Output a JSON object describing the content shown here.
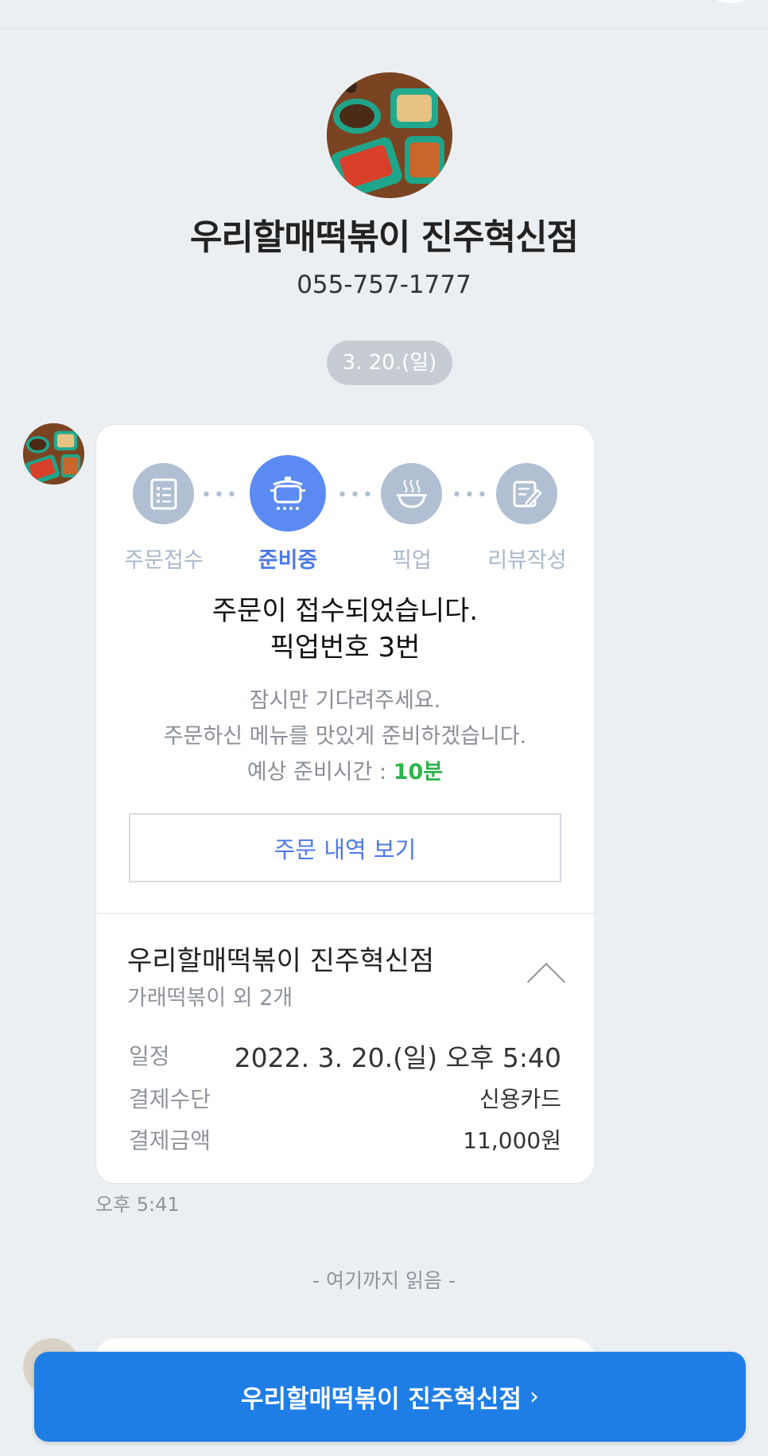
{
  "store": {
    "name": "우리할매떡볶이 진주혁신점",
    "phone": "055-757-1777"
  },
  "chat": {
    "date_chip": "3. 20.(일)",
    "message_time": "오후 5:41",
    "read_marker": "- 여기까지 읽음 -"
  },
  "order_card": {
    "steps": [
      {
        "label": "주문접수",
        "icon": "order-list-icon",
        "active": false
      },
      {
        "label": "준비중",
        "icon": "cooking-pot-icon",
        "active": true
      },
      {
        "label": "픽업",
        "icon": "food-bowl-icon",
        "active": false
      },
      {
        "label": "리뷰작성",
        "icon": "review-write-icon",
        "active": false
      }
    ],
    "status_line1": "주문이 접수되었습니다.",
    "status_line2": "픽업번호 3번",
    "sub_line1": "잠시만 기다려주세요.",
    "sub_line2": "주문하신 메뉴를 맛있게 준비하겠습니다.",
    "eta_label": "예상 준비시간 : ",
    "eta_value": "10분",
    "view_order_button": "주문 내역 보기",
    "summary": {
      "store_name": "우리할매떡볶이 진주혁신점",
      "items": "가래떡볶이 외 2개",
      "rows": [
        {
          "label": "일정",
          "value": "2022. 3. 20.(일) 오후 5:40"
        },
        {
          "label": "결제수단",
          "value": "신용카드"
        },
        {
          "label": "결제금액",
          "value": "11,000원"
        }
      ]
    }
  },
  "bottom_button": {
    "label": "우리할매떡볶이 진주혁신점",
    "chevron": "›"
  },
  "colors": {
    "active_step": "#5b8bf2",
    "inactive_step": "#b0bfd1",
    "eta_green": "#2db34a",
    "primary_button": "#1f7ee6",
    "background": "#eceff2"
  }
}
